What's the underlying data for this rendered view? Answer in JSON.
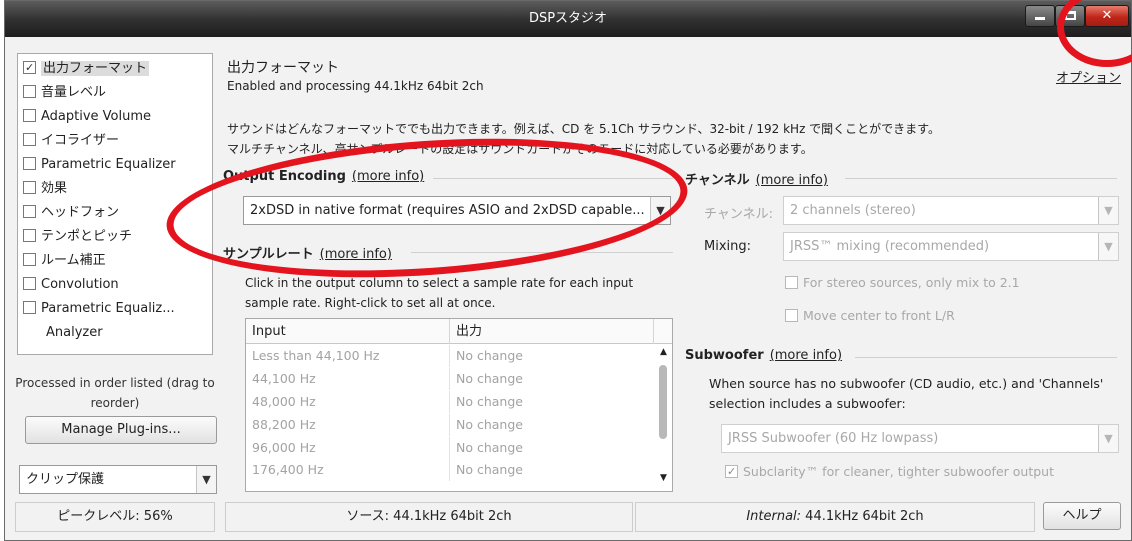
{
  "window": {
    "title": "DSPスタジオ"
  },
  "sidebar": {
    "items": [
      {
        "label": "出力フォーマット",
        "checked": true
      },
      {
        "label": "音量レベル",
        "checked": false
      },
      {
        "label": "Adaptive Volume",
        "checked": false
      },
      {
        "label": "イコライザー",
        "checked": false
      },
      {
        "label": "Parametric Equalizer",
        "checked": false
      },
      {
        "label": "効果",
        "checked": false
      },
      {
        "label": "ヘッドフォン",
        "checked": false
      },
      {
        "label": "テンポとピッチ",
        "checked": false
      },
      {
        "label": "ルーム補正",
        "checked": false
      },
      {
        "label": "Convolution",
        "checked": false
      },
      {
        "label": "Parametric Equaliz...",
        "checked": false
      },
      {
        "label": "Analyzer"
      }
    ],
    "note": "Processed in order listed (drag to reorder)",
    "manage_button": "Manage Plug-ins...",
    "preset_select": "クリップ保護"
  },
  "main": {
    "title": "出力フォーマット",
    "subtitle": "Enabled and processing 44.1kHz 64bit 2ch",
    "options_link": "オプション",
    "description_line1": "サウンドはどんなフォーマットででも出力できます。例えば、CD を 5.1Ch サラウンド、32-bit / 192 kHz で聞くことができます。",
    "description_line2": "マルチチャンネル、高サンプルレートの設定はサウンドカードがそのモードに対応している必要があります。"
  },
  "output_encoding": {
    "heading": "Output Encoding",
    "more_info": "(more info)",
    "value": "2xDSD in native format (requires ASIO and 2xDSD capable..."
  },
  "sample_rate": {
    "heading": "サンプルレート",
    "more_info": "(more info)",
    "help_line1": "Click in the output column to select a sample rate for each input",
    "help_line2": "sample rate.  Right-click to set all at once.",
    "columns": [
      "Input",
      "出力"
    ],
    "rows": [
      [
        "Less than 44,100 Hz",
        "No change"
      ],
      [
        "44,100 Hz",
        "No change"
      ],
      [
        "48,000 Hz",
        "No change"
      ],
      [
        "88,200 Hz",
        "No change"
      ],
      [
        "96,000 Hz",
        "No change"
      ],
      [
        "176,400 Hz",
        "No change"
      ]
    ]
  },
  "channels": {
    "heading": "チャンネル",
    "more_info": "(more info)",
    "channel_label": "チャンネル:",
    "channel_value": "2 channels (stereo)",
    "mixing_label": "Mixing:",
    "mixing_value": "JRSS™ mixing (recommended)",
    "stereo_only": "For stereo sources, only mix to 2.1",
    "move_center": "Move center to front L/R"
  },
  "subwoofer": {
    "heading": "Subwoofer",
    "more_info": "(more info)",
    "desc_line1": "When source has no subwoofer (CD audio, etc.) and 'Channels'",
    "desc_line2": "selection includes a subwoofer:",
    "value": "JRSS Subwoofer (60 Hz lowpass)",
    "subclarity": "Subclarity™ for cleaner, tighter subwoofer output",
    "subclarity_checked": true
  },
  "statusbar": {
    "peak": "ピークレベル: 56%",
    "source": "ソース: 44.1kHz 64bit 2ch",
    "internal_label": "Internal:",
    "internal_value": "44.1kHz 64bit 2ch",
    "help_button": "ヘルプ"
  },
  "colors": {
    "annotation": "#e4141e",
    "titlebar": "#2f2f2f",
    "close": "#c0261a"
  }
}
